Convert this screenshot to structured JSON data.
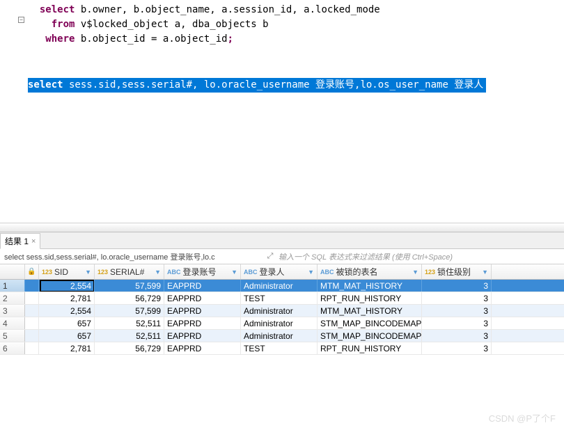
{
  "editor": {
    "fold_symbol": "−",
    "sql1": {
      "kw_select": "select",
      "cols": " b.owner, b.object_name, a.session_id, a.locked_mode",
      "kw_from": "from",
      "from_body": " v$locked_object a, dba_objects b",
      "kw_where": "where",
      "where_body": " b.object_id = a.object_id",
      "semicolon": ";"
    },
    "sql2": {
      "kw_select": "select",
      "body": " sess.sid,sess.serial#, lo.oracle_username 登录账号,lo.os_user_name 登录人"
    }
  },
  "tabs": {
    "result_label": "结果 1",
    "close": "×"
  },
  "filter": {
    "sql_text": "select sess.sid,sess.serial#, lo.oracle_username 登录账号,lo.c",
    "expand": "⤢",
    "placeholder": "输入一个 SQL 表达式来过滤结果 (使用 Ctrl+Space)"
  },
  "columns": {
    "lock": "🔒",
    "sid": "SID",
    "serial": "SERIAL#",
    "login_user": "登录账号",
    "login_person": "登录人",
    "locked_table": "被锁的表名",
    "lock_mode": "锁住级别",
    "type_num": "123",
    "type_abc": "ABC",
    "dd": "▼"
  },
  "rows": [
    {
      "n": "1",
      "sid": "2,554",
      "serial": "57,599",
      "user": "EAPPRD",
      "os": "Administrator",
      "obj": "MTM_MAT_HISTORY",
      "mode": "3",
      "sel": true
    },
    {
      "n": "2",
      "sid": "2,781",
      "serial": "56,729",
      "user": "EAPPRD",
      "os": "TEST",
      "obj": "RPT_RUN_HISTORY",
      "mode": "3"
    },
    {
      "n": "3",
      "sid": "2,554",
      "serial": "57,599",
      "user": "EAPPRD",
      "os": "Administrator",
      "obj": "MTM_MAT_HISTORY",
      "mode": "3",
      "alt": true
    },
    {
      "n": "4",
      "sid": "657",
      "serial": "52,511",
      "user": "EAPPRD",
      "os": "Administrator",
      "obj": "STM_MAP_BINCODEMAP",
      "mode": "3"
    },
    {
      "n": "5",
      "sid": "657",
      "serial": "52,511",
      "user": "EAPPRD",
      "os": "Administrator",
      "obj": "STM_MAP_BINCODEMAP",
      "mode": "3",
      "alt": true
    },
    {
      "n": "6",
      "sid": "2,781",
      "serial": "56,729",
      "user": "EAPPRD",
      "os": "TEST",
      "obj": "RPT_RUN_HISTORY",
      "mode": "3"
    }
  ],
  "watermark": "CSDN @P了个F"
}
